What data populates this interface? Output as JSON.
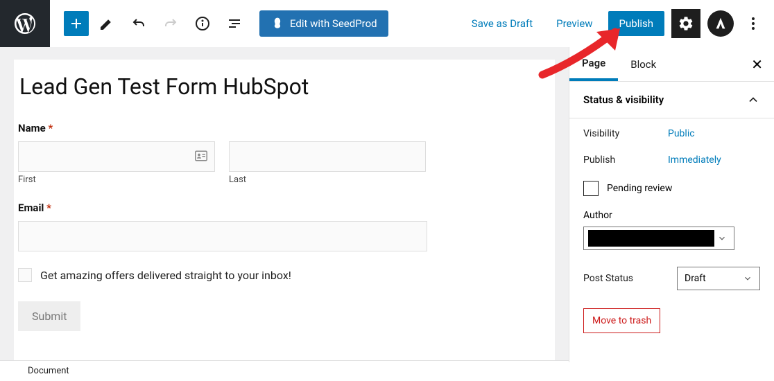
{
  "toolbar": {
    "seedprod_label": "Edit with SeedProd",
    "save_draft_label": "Save as Draft",
    "preview_label": "Preview",
    "publish_label": "Publish"
  },
  "editor": {
    "page_title": "Lead Gen Test Form HubSpot",
    "form": {
      "name_label": "Name",
      "first_sub": "First",
      "last_sub": "Last",
      "email_label": "Email",
      "offers_label": "Get amazing offers delivered straight to your inbox!",
      "submit_label": "Submit"
    }
  },
  "sidebar": {
    "tabs": {
      "page": "Page",
      "block": "Block"
    },
    "panel_title": "Status & visibility",
    "visibility_label": "Visibility",
    "visibility_value": "Public",
    "publish_label": "Publish",
    "publish_value": "Immediately",
    "pending_label": "Pending review",
    "author_label": "Author",
    "post_status_label": "Post Status",
    "post_status_value": "Draft",
    "trash_label": "Move to trash"
  },
  "footer": {
    "breadcrumb": "Document"
  }
}
